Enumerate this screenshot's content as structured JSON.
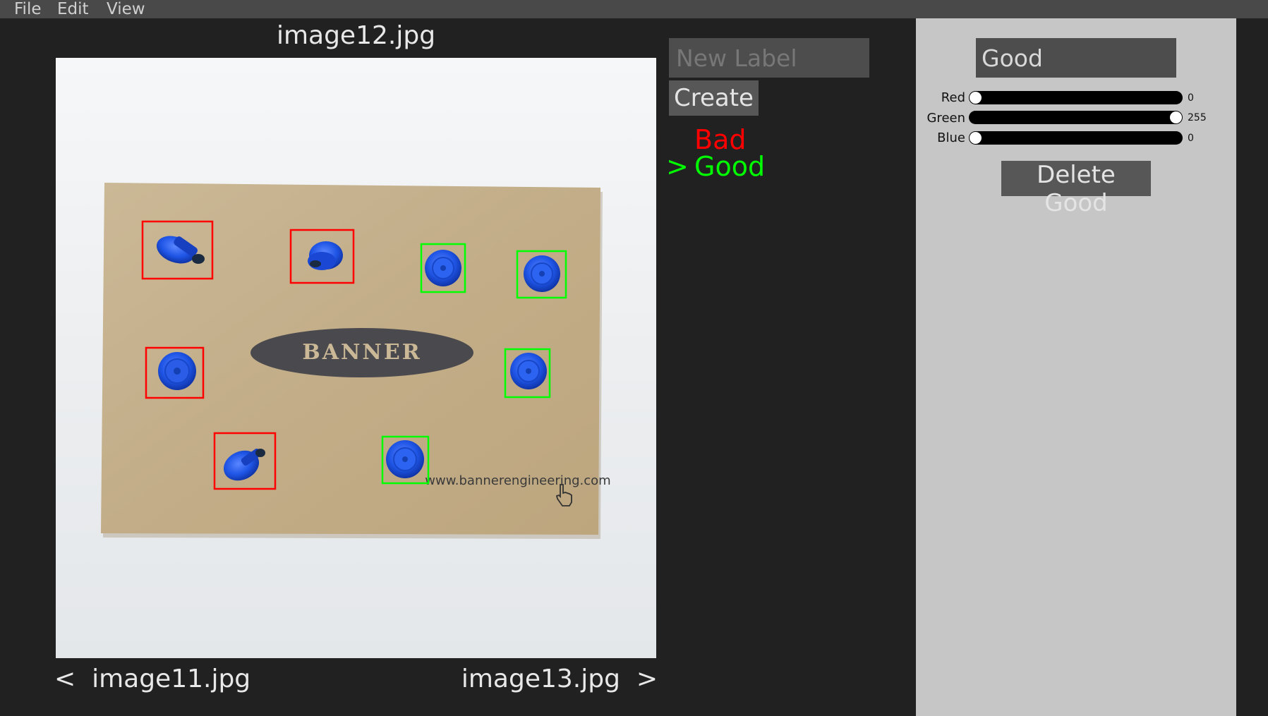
{
  "menu": {
    "file": "File",
    "edit": "Edit",
    "view": "View"
  },
  "viewer": {
    "title": "image12.jpg",
    "prev_label": "image11.jpg",
    "next_label": "image13.jpg",
    "prev_arrow": "<",
    "next_arrow": ">",
    "photo": {
      "logo_text": "BANNER",
      "website_text": "www.bannerengineering.com"
    }
  },
  "labels_panel": {
    "new_label_placeholder": "New Label",
    "create_button": "Create",
    "cursor": ">",
    "labels": [
      {
        "name": "Bad",
        "color": "#ff0000",
        "selected": false
      },
      {
        "name": "Good",
        "color": "#00ff00",
        "selected": true
      }
    ]
  },
  "label_editor": {
    "name": "Good",
    "sliders": [
      {
        "label": "Red",
        "value": 0
      },
      {
        "label": "Green",
        "value": 255
      },
      {
        "label": "Blue",
        "value": 0
      }
    ],
    "delete_button": "Delete Good"
  },
  "annotations": [
    {
      "label": "Bad",
      "color": "#ff0000"
    },
    {
      "label": "Bad",
      "color": "#ff0000"
    },
    {
      "label": "Good",
      "color": "#00ff00"
    },
    {
      "label": "Good",
      "color": "#00ff00"
    },
    {
      "label": "Bad",
      "color": "#ff0000"
    },
    {
      "label": "Good",
      "color": "#00ff00"
    },
    {
      "label": "Bad",
      "color": "#ff0000"
    },
    {
      "label": "Good",
      "color": "#00ff00"
    }
  ]
}
